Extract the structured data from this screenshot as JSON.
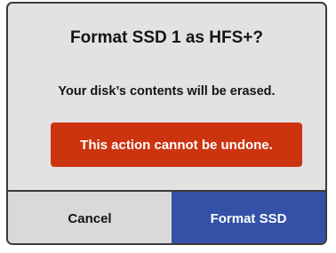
{
  "dialog": {
    "title": "Format SSD 1 as HFS+?",
    "message": "Your disk’s contents will be erased.",
    "warning": "This action cannot be undone.",
    "cancel_label": "Cancel",
    "confirm_label": "Format SSD"
  },
  "colors": {
    "warning_bg": "#cc3410",
    "primary_bg": "#3351a6",
    "dialog_bg": "#e2e2e2"
  }
}
